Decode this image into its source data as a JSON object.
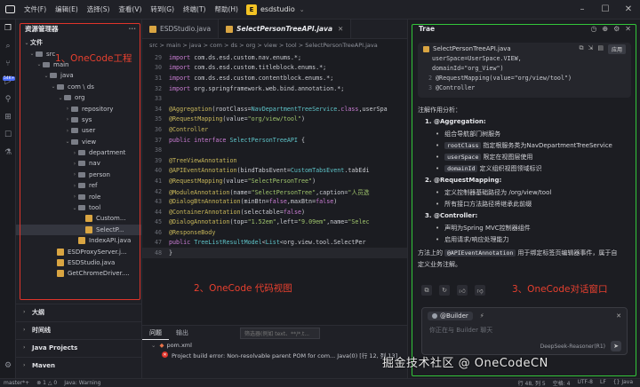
{
  "titlebar": {
    "menu": [
      "文件(F)",
      "编辑(E)",
      "选择(S)",
      "查看(V)",
      "转到(G)",
      "终端(T)",
      "帮助(H)"
    ],
    "workspace_letter": "E",
    "workspace_name": "esdstudio"
  },
  "activity_badge": "54K+",
  "sidebar": {
    "title": "资源管理器",
    "section_files": "文件",
    "tree": [
      {
        "label": "src",
        "depth": 1,
        "type": "folder",
        "open": true
      },
      {
        "label": "main",
        "depth": 2,
        "type": "folder",
        "open": true
      },
      {
        "label": "java",
        "depth": 3,
        "type": "folder",
        "open": true
      },
      {
        "label": "com \\ ds",
        "depth": 4,
        "type": "folder",
        "open": true
      },
      {
        "label": "org",
        "depth": 5,
        "type": "folder",
        "open": true
      },
      {
        "label": "repository",
        "depth": 6,
        "type": "folder",
        "open": false
      },
      {
        "label": "sys",
        "depth": 6,
        "type": "folder",
        "open": false
      },
      {
        "label": "user",
        "depth": 6,
        "type": "folder",
        "open": false
      },
      {
        "label": "view",
        "depth": 6,
        "type": "folder",
        "open": true
      },
      {
        "label": "department",
        "depth": 7,
        "type": "folder",
        "open": false
      },
      {
        "label": "nav",
        "depth": 7,
        "type": "folder",
        "open": false
      },
      {
        "label": "person",
        "depth": 7,
        "type": "folder",
        "open": false
      },
      {
        "label": "ref",
        "depth": 7,
        "type": "folder",
        "open": false
      },
      {
        "label": "role",
        "depth": 7,
        "type": "folder",
        "open": false
      },
      {
        "label": "tool",
        "depth": 7,
        "type": "folder",
        "open": true
      },
      {
        "label": "Custom...",
        "depth": 8,
        "type": "file"
      },
      {
        "label": "SelectP...",
        "depth": 8,
        "type": "file",
        "selected": true
      },
      {
        "label": "IndexAPI.java",
        "depth": 7,
        "type": "file"
      },
      {
        "label": "ESDProxyServer.j...",
        "depth": 4,
        "type": "file"
      },
      {
        "label": "ESDStudio.java",
        "depth": 4,
        "type": "file"
      },
      {
        "label": "GetChromeDriver....",
        "depth": 4,
        "type": "file"
      }
    ],
    "sections": [
      "大纲",
      "时间线",
      "Java Projects",
      "Maven"
    ],
    "annotation": "1、OneCode工程"
  },
  "editor": {
    "tabs": [
      {
        "label": "ESDStudio.java",
        "active": false
      },
      {
        "label": "SelectPersonTreeAPI.java",
        "active": true
      }
    ],
    "breadcrumb": "src > main > java > com > ds > org > view > tool > SelectPersonTreeAPI.java",
    "lines": [
      {
        "n": "29",
        "html": "<span class='kw'>import</span> com.ds.esd.custom.nav.enums.*;"
      },
      {
        "n": "30",
        "html": "<span class='kw'>import</span> com.ds.esd.custom.titleblock.enums.*;"
      },
      {
        "n": "31",
        "html": "<span class='kw'>import</span> com.ds.esd.custom.contentblock.enums.*;"
      },
      {
        "n": "32",
        "html": "<span class='kw'>import</span> org.springframework.web.bind.annotation.*;"
      },
      {
        "n": "33",
        "html": ""
      },
      {
        "n": "34",
        "html": "<span class='an'>@Aggregation</span>(rootClass=<span class='ty'>NavDepartmentTreeService</span>.<span class='kw'>class</span>,userSpa"
      },
      {
        "n": "35",
        "html": "<span class='an'>@RequestMapping</span>(value=<span class='str'>\"org/view/tool\"</span>)"
      },
      {
        "n": "36",
        "html": "<span class='an'>@Controller</span>"
      },
      {
        "n": "37",
        "html": "<span class='kw'>public interface</span> <span class='ty'>SelectPersonTreeAPI</span>  {"
      },
      {
        "n": "38",
        "html": ""
      },
      {
        "n": "39",
        "html": "    <span class='an'>@TreeViewAnnotation</span>"
      },
      {
        "n": "40",
        "html": "    <span class='an'>@APIEventAnnotation</span>(bindTabsEvent=<span class='ty'>CustomTabsEvent</span>.tabEdi"
      },
      {
        "n": "41",
        "html": "    <span class='an'>@RequestMapping</span>(value=<span class='str'>\"SelectPersonTree\"</span>)"
      },
      {
        "n": "42",
        "html": "    <span class='an'>@ModuleAnnotation</span>(name=<span class='str'>\"SelectPersonTree\"</span>,caption=<span class='str'>\"人员选</span>"
      },
      {
        "n": "43",
        "html": "    <span class='an'>@DialogBtnAnnotation</span>(minBtn=<span class='kw'>false</span>,maxBtn=<span class='kw'>false</span>)"
      },
      {
        "n": "44",
        "html": "    <span class='an'>@ContainerAnnotation</span>(selectable=<span class='kw'>false</span>)"
      },
      {
        "n": "45",
        "html": "    <span class='an'>@DialogAnnotation</span>(top=<span class='str'>\"1.52em\"</span>,left=<span class='str'>\"9.09em\"</span>,name=<span class='str'>\"Selec</span>"
      },
      {
        "n": "46",
        "html": "    <span class='an'>@ResponseBody</span>"
      },
      {
        "n": "47",
        "html": "    <span class='kw'>public</span>  <span class='ty'>TreeListResultModel</span>&lt;<span class='ty'>List</span>&lt;org.view.tool.SelectPer"
      },
      {
        "n": "48",
        "html": "}"
      }
    ],
    "annotation": "2、OneCode 代码视图"
  },
  "bottom": {
    "tabs": [
      "问题",
      "输出"
    ],
    "filter_placeholder": "筛选器(例如 text、**/*.t...",
    "problems": [
      "pom.xml",
      "Project build error: Non-resolvable parent POM for com...  Java(0) [行 12, 列 13]"
    ]
  },
  "chat": {
    "title": "Trae",
    "snippet_file": "SelectPersonTreeAPI.java",
    "apply_label": "应用",
    "snippet_lines": [
      {
        "n": "",
        "t": "  userSpace=UserSpace.VIEW,"
      },
      {
        "n": "",
        "t": "  domainId=\"org_View\")"
      },
      {
        "n": "2",
        "t": "@RequestMapping(value=\"org/view/tool\")"
      },
      {
        "n": "3",
        "t": "@Controller"
      }
    ],
    "intro": "注解作用分析：",
    "sections": [
      {
        "heading": "1. @Aggregation:",
        "items": [
          {
            "chip": "",
            "text": "组合导航部门树服务"
          },
          {
            "chip": "rootClass",
            "text": "指定根服务类为NavDepartmentTreeService"
          },
          {
            "chip": "userSpace",
            "text": "限定在视图层使用"
          },
          {
            "chip": "domainId",
            "text": "定义组织视图领域标识"
          }
        ]
      },
      {
        "heading": "2. @RequestMapping:",
        "items": [
          {
            "chip": "",
            "text": "定义控制器基础路径为 /org/view/tool"
          },
          {
            "chip": "",
            "text": "所有接口方法路径将继承此前缀"
          }
        ]
      },
      {
        "heading": "3. @Controller:",
        "items": [
          {
            "chip": "",
            "text": "声明为Spring MVC控制器组件"
          },
          {
            "chip": "",
            "text": "启用请求/响应处理能力"
          }
        ]
      }
    ],
    "footer_pre": "方法上的",
    "footer_chip": "@APIEventAnnotation",
    "footer_post": "用于绑定标签页编辑器事件，属于自",
    "footer_line2": "定义业务注解。",
    "builder_label": "@Builder",
    "input_placeholder": "你正在与 Builder 聊天",
    "model_label": "DeepSeek-Reasoner(R1)",
    "annotation": "3、OneCode对话窗口"
  },
  "statusbar": {
    "left": [
      "master*+",
      "⊗ 1 △ 0",
      "Java: Warning"
    ],
    "right": [
      "行 48, 列 5",
      "空格: 4",
      "UTF-8",
      "LF",
      "{} Java"
    ]
  },
  "watermark": "掘金技术社区 @ OneCodeCN"
}
